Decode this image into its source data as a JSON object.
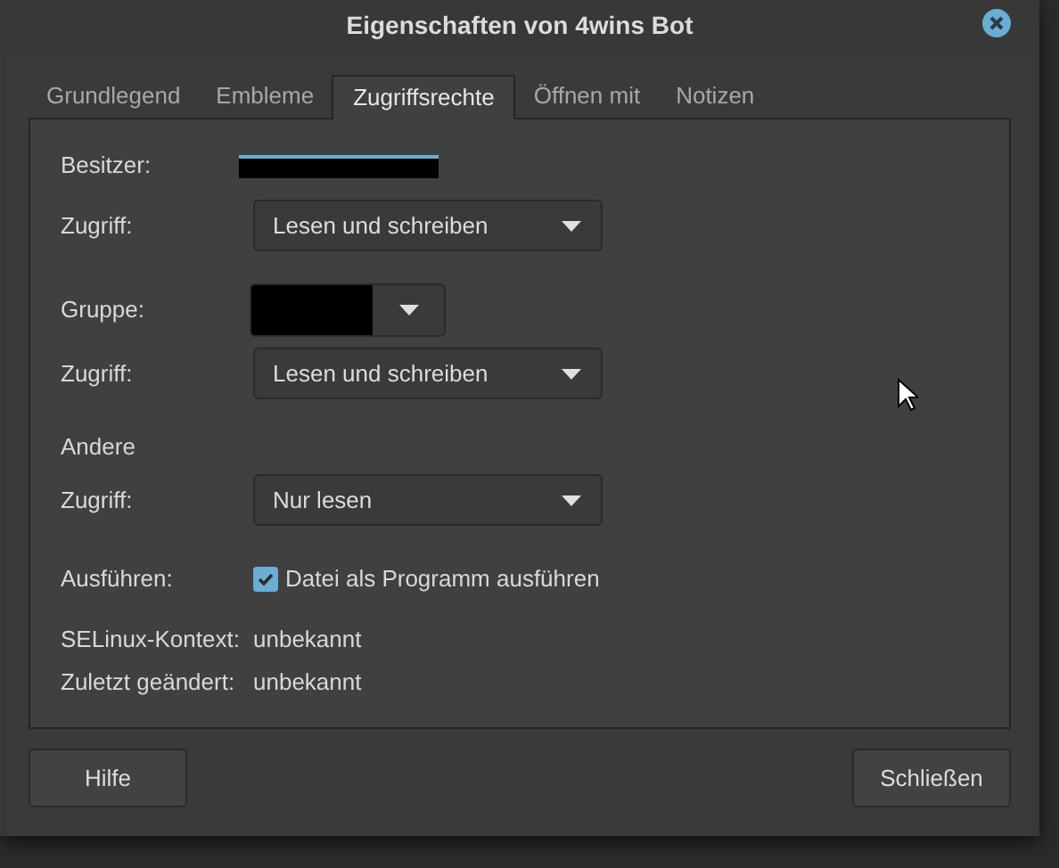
{
  "window": {
    "title": "Eigenschaften von 4wins Bot"
  },
  "tabs": [
    {
      "label": "Grundlegend",
      "selected": false
    },
    {
      "label": "Embleme",
      "selected": false
    },
    {
      "label": "Zugriffsrechte",
      "selected": true
    },
    {
      "label": "Öffnen mit",
      "selected": false
    },
    {
      "label": "Notizen",
      "selected": false
    }
  ],
  "owner": {
    "label": "Besitzer:",
    "access": {
      "label": "Zugriff:",
      "value": "Lesen und schreiben"
    }
  },
  "group": {
    "label": "Gruppe:",
    "access": {
      "label": "Zugriff:",
      "value": "Lesen und schreiben"
    }
  },
  "others": {
    "heading": "Andere",
    "access": {
      "label": "Zugriff:",
      "value": "Nur lesen"
    }
  },
  "execute": {
    "label": "Ausführen:",
    "option": "Datei als Programm ausführen",
    "checked": true
  },
  "info": [
    {
      "label": "SELinux-Kontext:",
      "value": "unbekannt"
    },
    {
      "label": "Zuletzt geändert:",
      "value": "unbekannt"
    }
  ],
  "buttons": {
    "help": "Hilfe",
    "close": "Schließen"
  }
}
